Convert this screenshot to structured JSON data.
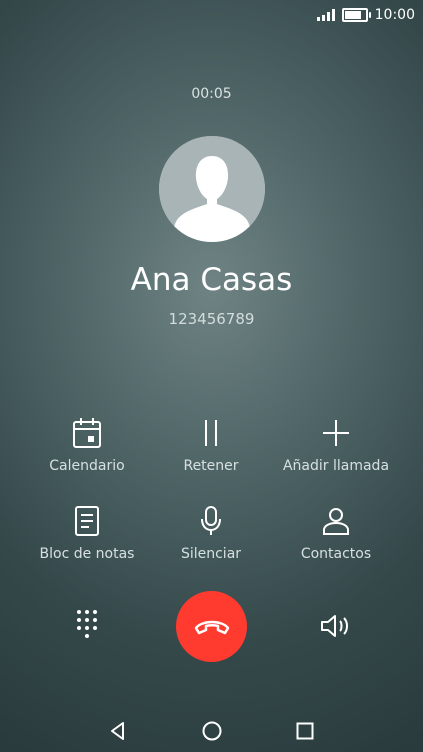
{
  "status_bar": {
    "time": "10:00",
    "battery_level": 1.0
  },
  "call": {
    "duration": "00:05",
    "contact_name": "Ana Casas",
    "contact_number": "123456789"
  },
  "actions": {
    "calendar": "Calendario",
    "hold": "Retener",
    "add_call": "Añadir llamada",
    "notes": "Bloc de notas",
    "mute": "Silenciar",
    "contacts": "Contactos"
  },
  "controls": {
    "dialpad_icon": "dialpad-icon",
    "end_call_icon": "end-call-icon",
    "speaker_icon": "speaker-icon",
    "end_call_color": "#ff3b30"
  },
  "nav": {
    "back_icon": "back-triangle-icon",
    "home_icon": "home-circle-icon",
    "recents_icon": "recents-square-icon"
  }
}
